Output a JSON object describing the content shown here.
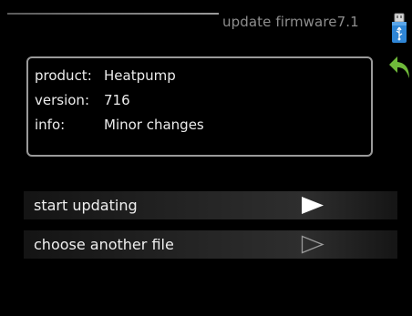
{
  "header": {
    "title": "update firmware7.1"
  },
  "info_panel": {
    "rows": [
      {
        "label": "product:",
        "value": "Heatpump"
      },
      {
        "label": "version:",
        "value": "716"
      },
      {
        "label": "info:",
        "value": "Minor changes"
      }
    ]
  },
  "menu": {
    "items": [
      {
        "label": "start updating",
        "selected": true
      },
      {
        "label": "choose another file",
        "selected": false
      }
    ]
  },
  "icons": {
    "usb": "usb-stick-icon",
    "back": "back-arrow-icon"
  },
  "colors": {
    "background": "#000000",
    "title": "#8e8e8e",
    "accent_usb": "#2f86d6",
    "back_arrow": "#6fb93a",
    "box_border": "#9a9a9a"
  }
}
